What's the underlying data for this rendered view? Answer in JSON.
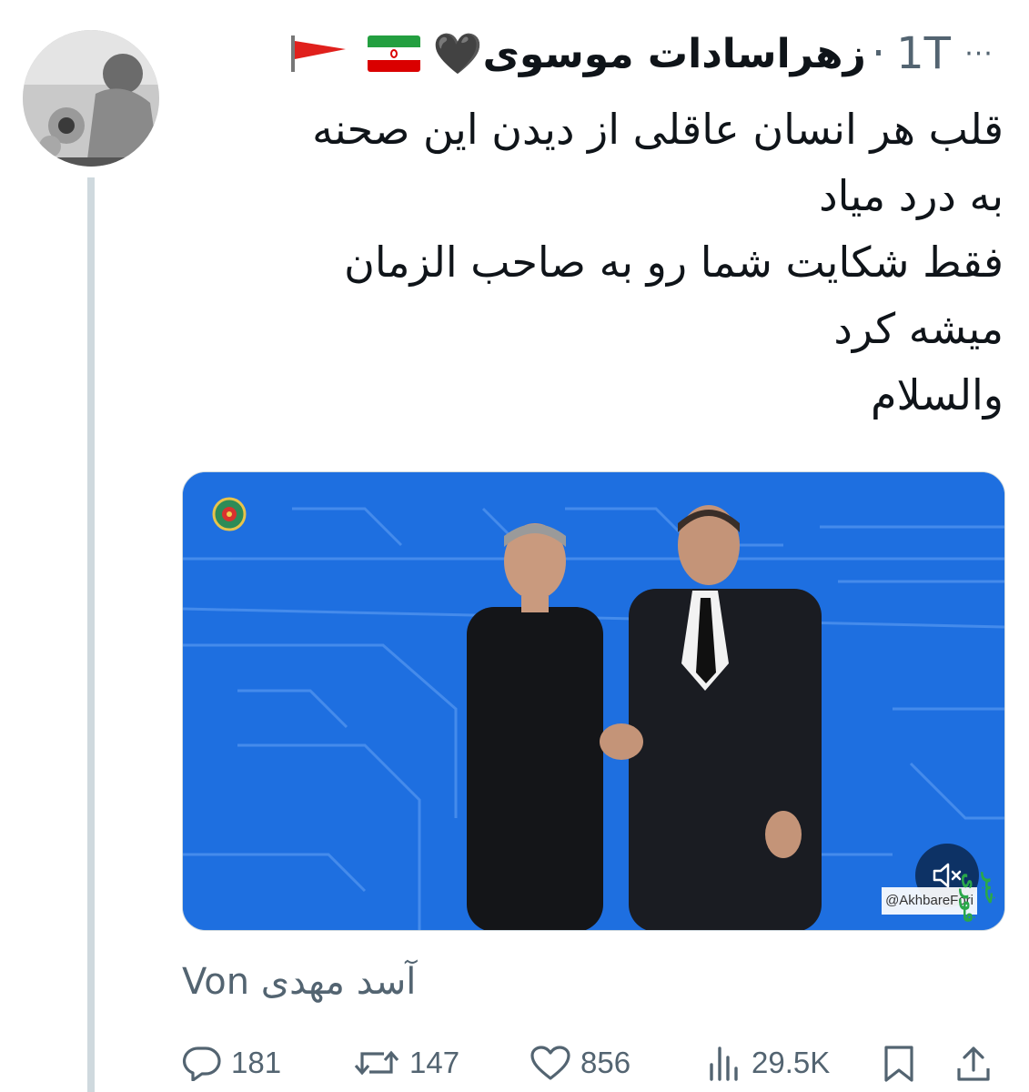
{
  "tweet": {
    "display_name": "زهراسادات موسوی🖤",
    "timestamp": "1T",
    "dot": "·",
    "more": "···",
    "text_lines": [
      "قلب هر انسان عاقلی از دیدن این صحنه",
      "به درد میاد",
      "فقط شکایت شما رو به صاحب الزمان",
      "میشه کرد",
      "والسلام"
    ],
    "attribution": "آسد مهدی Von"
  },
  "media": {
    "watermark": "@AkhbareFori",
    "channel_logo": "خبر فوری",
    "background_color": "#1e6fe0"
  },
  "actions": {
    "replies": "181",
    "retweets": "147",
    "likes": "856",
    "views": "29.5K"
  },
  "icons": [
    "more-icon",
    "flag-iran-icon",
    "pennant-icon",
    "reply-icon",
    "retweet-icon",
    "like-icon",
    "views-icon",
    "bookmark-icon",
    "share-icon",
    "mute-icon",
    "emblem-icon"
  ]
}
